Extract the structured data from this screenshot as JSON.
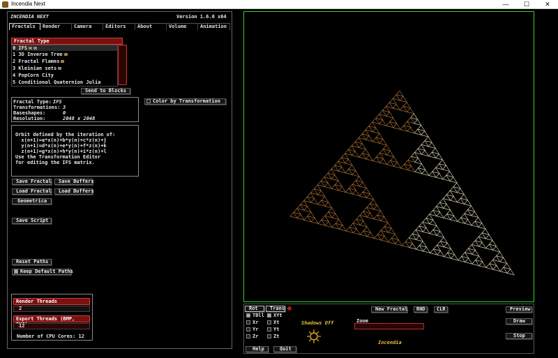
{
  "window": {
    "title": "Incendia Next",
    "minimize": "—",
    "maximize": "☐",
    "close": "✕"
  },
  "header": {
    "app_name": "INCENDIA NEXT",
    "version": "Version 1.6.0 x64"
  },
  "tabs": [
    {
      "label": "Fractals"
    },
    {
      "label": "Render"
    },
    {
      "label": "Camera"
    },
    {
      "label": "Editors"
    },
    {
      "label": "About"
    },
    {
      "label": "Volume"
    },
    {
      "label": "Animation"
    }
  ],
  "fractal_type": {
    "label": "Fractal Type",
    "items": [
      {
        "label": "0 IFS"
      },
      {
        "label": "1 3D Inverse Tree"
      },
      {
        "label": "2 Fractal Flames"
      },
      {
        "label": "3 Kleinian sets"
      },
      {
        "label": "4 PopCorn City"
      },
      {
        "label": "5 Conditional Quaternion Julia"
      }
    ],
    "send_to_blocks": "Send to Blocks"
  },
  "color_by_transformation": "Color by Transformation",
  "info": {
    "fractal_type_label": "Fractal Type:",
    "fractal_type_value": "IFS",
    "transformations_label": "Transformations:",
    "transformations_value": "3",
    "baseshapes_label": "Baseshapes:",
    "baseshapes_value": "0",
    "resolution_label": "Resolution:",
    "resolution_value": "2048 x 2048"
  },
  "description": {
    "lines": [
      "Orbit defined by the iteration of:",
      "  x(n+1)=a*x(n)+b*y(n)+c*z(n)+j",
      "  y(n+1)=d*x(n)+e*y(n)+f*z(n)+k",
      "  z(n+1)=g*x(n)+h*y(n)+i*z(n)+l",
      "Use the Transformation Editor",
      "for editing the IFS matrix."
    ]
  },
  "buttons": {
    "save_fractal": "Save Fractal",
    "save_buffers": "Save Buffers",
    "load_fractal": "Load Fractal",
    "load_buffers": "Load Buffers",
    "geometrica": "Geometrica",
    "save_script": "Save Script",
    "reset_paths": "Reset Paths",
    "keep_default_paths": "Keep Default Paths"
  },
  "threads": {
    "render_label": "Render Threads",
    "render_value": "2",
    "export_label": "Export Threads (BMP, PNG)",
    "export_value": "12",
    "cpu_cores": "Number of CPU Cores: 12",
    "render_level": 0.17,
    "export_level": 1.0
  },
  "bottom": {
    "rot": "Rot",
    "trans": "Trans",
    "rot_items": [
      {
        "label": "TBll"
      },
      {
        "label": "Xr"
      },
      {
        "label": "Yr"
      },
      {
        "label": "Zr"
      }
    ],
    "trans_items": [
      {
        "label": "XYt"
      },
      {
        "label": "Xt"
      },
      {
        "label": "Yt"
      },
      {
        "label": "Zt"
      }
    ],
    "shadows": "Shadows Off",
    "new_fractal": "New Fractal",
    "rnd": "RND",
    "clr": "CLR",
    "zoom": "Zoom",
    "incendia": "Incendia",
    "preview": "Preview",
    "draw": "Draw",
    "stop": "Stop",
    "help": "Help",
    "quit": "Quit"
  },
  "colors": {
    "accent_red": "#7a1010",
    "viewport_border": "#2bd42b",
    "fractal_start": "#e9e3c0",
    "fractal_end": "#b97a3a"
  }
}
